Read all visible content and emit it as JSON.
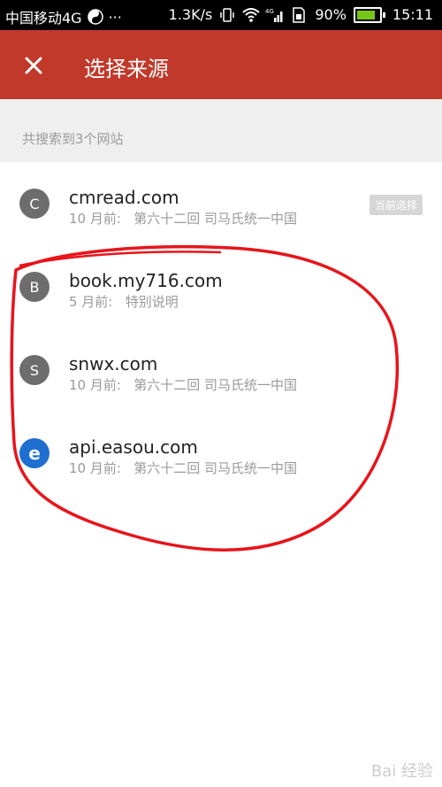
{
  "status_bar": {
    "carrier": "中国移动4G",
    "speed": "1.3K/s",
    "battery": "90%",
    "time": "15:11",
    "signal_label": "4G"
  },
  "app_bar": {
    "title": "选择来源",
    "close_icon": "close-icon",
    "background": "#c0392b"
  },
  "summary": {
    "text": "共搜索到3个网站"
  },
  "sources": [
    {
      "avatar": "C",
      "site": "cmread.com",
      "time": "10 月前:",
      "chapter": "第六十二回 司马氏统一中国",
      "badge": "当前选择"
    },
    {
      "avatar": "B",
      "site": "book.my716.com",
      "time": "5 月前:",
      "chapter": "特别说明"
    },
    {
      "avatar": "S",
      "site": "snwx.com",
      "time": "10 月前:",
      "chapter": "第六十二回 司马氏统一中国"
    },
    {
      "avatar": "e",
      "site": "api.easou.com",
      "time": "10 月前:",
      "chapter": "第六十二回 司马氏统一中国"
    }
  ],
  "watermark": "Bai 经验"
}
